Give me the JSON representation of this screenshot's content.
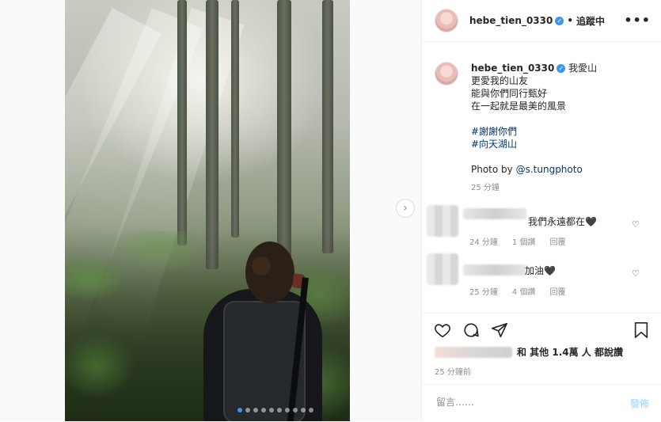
{
  "post": {
    "username": "hebe_tien_0330",
    "follow_separator": "•",
    "follow_label": "追蹤中",
    "more_label": "•••"
  },
  "caption": {
    "username": "hebe_tien_0330",
    "lines": [
      "我愛山",
      "更愛我的山友",
      "能與你們同行甄好",
      "在一起就是最美的風景"
    ],
    "hashtags": [
      "#謝謝你們",
      "#向天湖山"
    ],
    "photo_credit_prefix": "Photo by",
    "photo_credit_mention": "@s.tungphoto",
    "time": "25 分鐘"
  },
  "comments": [
    {
      "text": "我們永遠都在🖤",
      "time": "24 分鐘",
      "likes": "1 個讚",
      "reply": "回覆"
    },
    {
      "text": "加油🖤",
      "time": "25 分鐘",
      "likes": "4 個讚",
      "reply": "回覆"
    }
  ],
  "likes": {
    "text": "和 其他 1.4萬 人 都說讚"
  },
  "timestamp": "25 分鐘前",
  "comment_box": {
    "placeholder": "留言……",
    "post_label": "發佈"
  },
  "carousel": {
    "count": 10,
    "active_index": 0
  },
  "colors": {
    "link": "#00376b",
    "verified": "#3897f0",
    "post_disabled": "#b2dffc"
  }
}
